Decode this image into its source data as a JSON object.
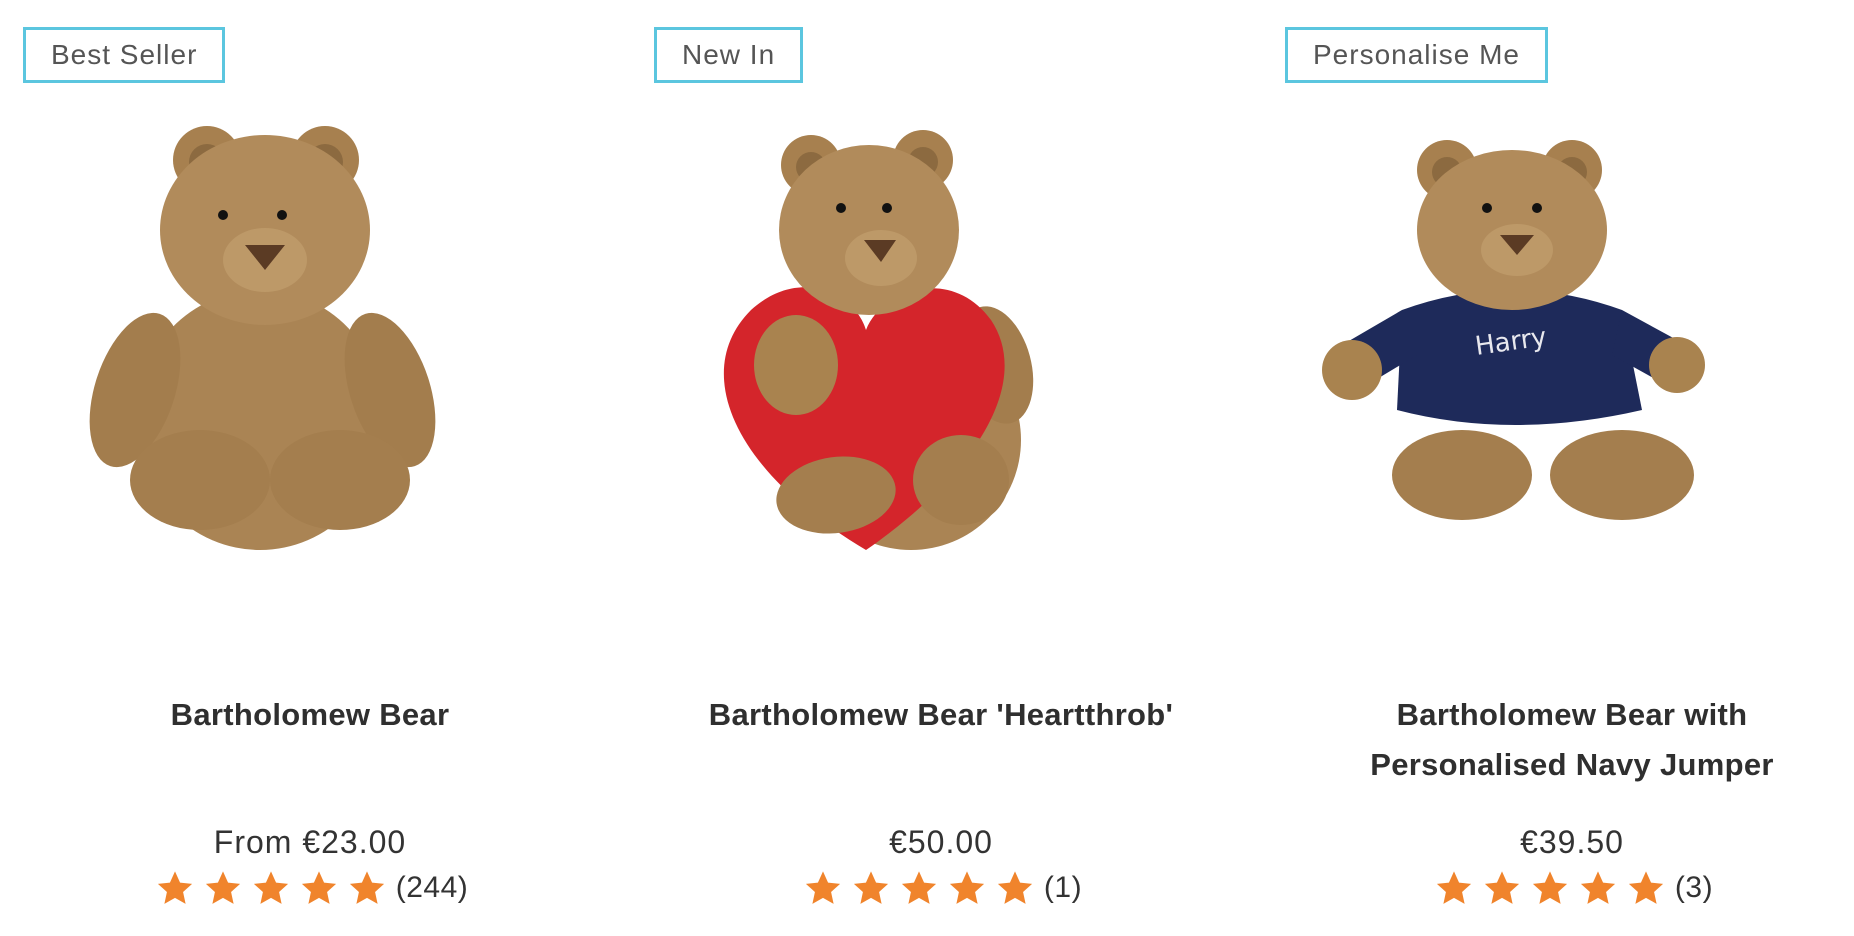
{
  "products": [
    {
      "badge": "Best Seller",
      "title_line1": "Bartholomew Bear",
      "title_line2": "",
      "price": "From €23.00",
      "rating": 5,
      "review_count": "(244)",
      "image": "brown-teddy-bear"
    },
    {
      "badge": "New In",
      "title_line1": "Bartholomew Bear 'Heartthrob'",
      "title_line2": "",
      "price": "€50.00",
      "rating": 5,
      "review_count": "(1)",
      "image": "teddy-bear-holding-red-heart"
    },
    {
      "badge": "Personalise Me",
      "title_line1": "Bartholomew Bear with",
      "title_line2": "Personalised Navy Jumper",
      "price": "€39.50",
      "rating": 5,
      "review_count": "(3)",
      "image": "teddy-bear-navy-jumper",
      "jumper_text": "Harry"
    }
  ],
  "colors": {
    "badge_border": "#5bc6df",
    "star": "#f0842c",
    "bear_fur": "#b08a5a",
    "heart": "#d4252b",
    "jumper": "#1e2a5a"
  }
}
